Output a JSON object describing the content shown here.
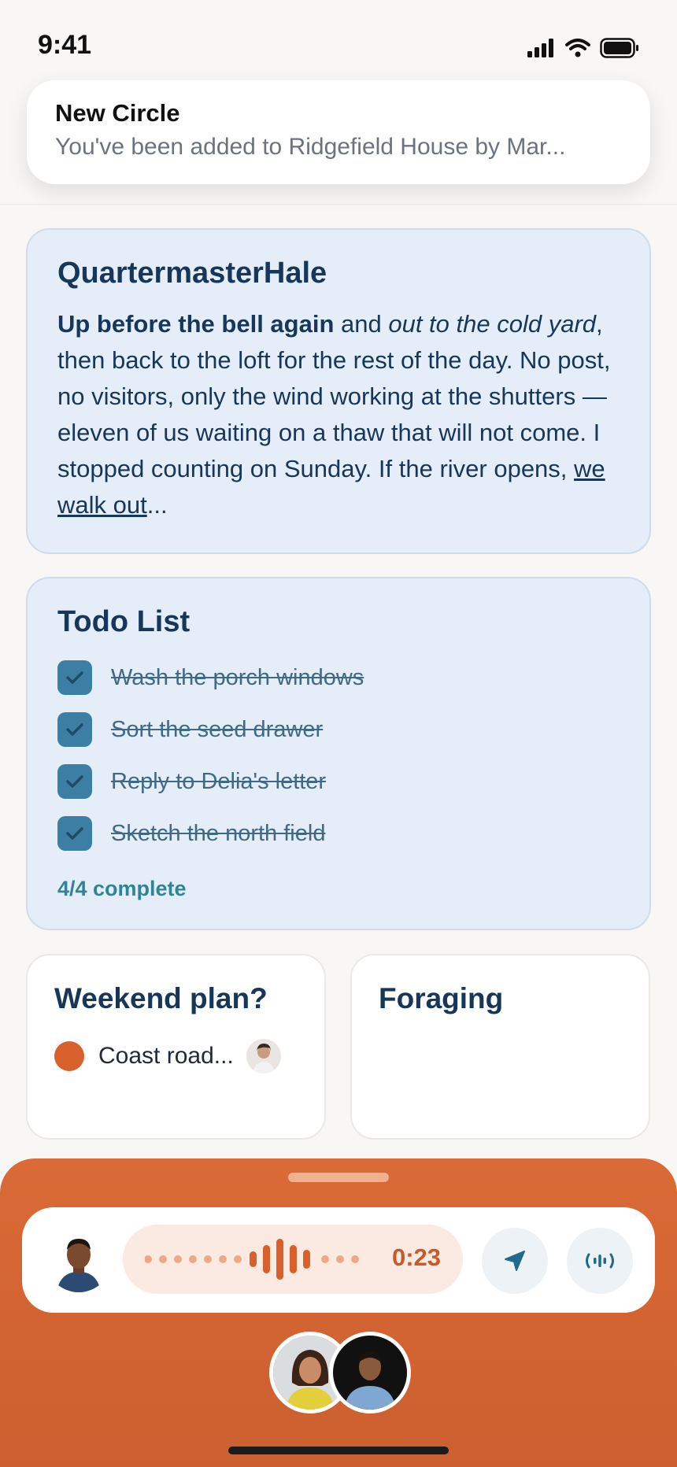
{
  "status_bar": {
    "time": "9:41"
  },
  "notification": {
    "title": "New Circle",
    "body": "You've been added to Ridgefield House by Mar..."
  },
  "post": {
    "author": "QuartermasterHale",
    "bold_lead": "Up before the bell again",
    "plain_1": " and ",
    "italic_part": "out to the cold yard",
    "plain_2": ", then back to the loft for the rest of the day. No post, no visitors, only the wind working at the shutters — eleven of us waiting on a thaw that will not come. I stopped counting on Sunday. If the river opens, ",
    "underline_part": "we walk out",
    "ellipsis": "..."
  },
  "todo": {
    "title": "Todo List",
    "items": [
      {
        "label": "Wash the porch windows",
        "done": true
      },
      {
        "label": "Sort the seed drawer",
        "done": true
      },
      {
        "label": "Reply to Delia's letter",
        "done": true
      },
      {
        "label": "Sketch the north field",
        "done": true
      }
    ],
    "progress": "4/4 complete"
  },
  "weekend": {
    "title": "Weekend plan?",
    "option_label": "Coast road...",
    "option_color": "#d8602b"
  },
  "foraging": {
    "title": "Foraging"
  },
  "composer": {
    "duration": "0:23",
    "accent": "#d8602b"
  },
  "colors": {
    "sheet": "#d8652f",
    "card_blue": "#e5eef8",
    "heading": "#16365a",
    "checkbox": "#3d7fa4",
    "progress": "#2f8597"
  }
}
